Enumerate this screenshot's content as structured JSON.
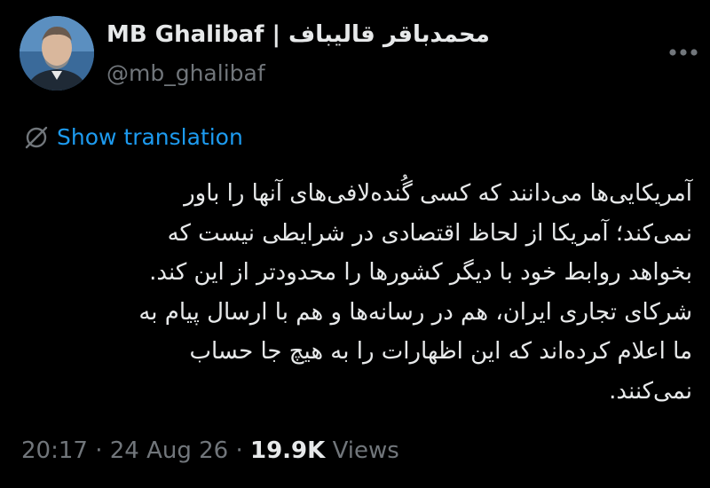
{
  "author": {
    "display_name": "MB Ghalibaf | محمدباقر قالیباف",
    "handle": "@mb_ghalibaf"
  },
  "actions": {
    "show_translation": "Show translation"
  },
  "tweet": {
    "lines": [
      "آمریکایی‌ها می‌دانند که کسی گُنده‌لافی‌های آنها را باور",
      "نمی‌کند؛ آمریکا از لحاظ اقتصادی در شرایطی نیست که",
      "بخواهد روابط خود با دیگر کشورها را محدودتر از این کند.",
      "شرکای تجاری ایران، هم در رسانه‌ها و هم با ارسال پیام به",
      "ما اعلام کرده‌اند که این اظهارات را به هیچ جا حساب",
      "نمی‌کنند."
    ]
  },
  "meta": {
    "time": "20:17",
    "separator": "·",
    "date": "24 Aug 26",
    "views_count": "19.9K",
    "views_label": "Views"
  },
  "colors": {
    "background": "#000000",
    "text_primary": "#e7e9ea",
    "text_secondary": "#71767b",
    "link": "#1d9bf0"
  },
  "icons": {
    "avatar": "profile-photo",
    "more": "more-horizontal-icon",
    "translate": "translate-globe-icon"
  }
}
